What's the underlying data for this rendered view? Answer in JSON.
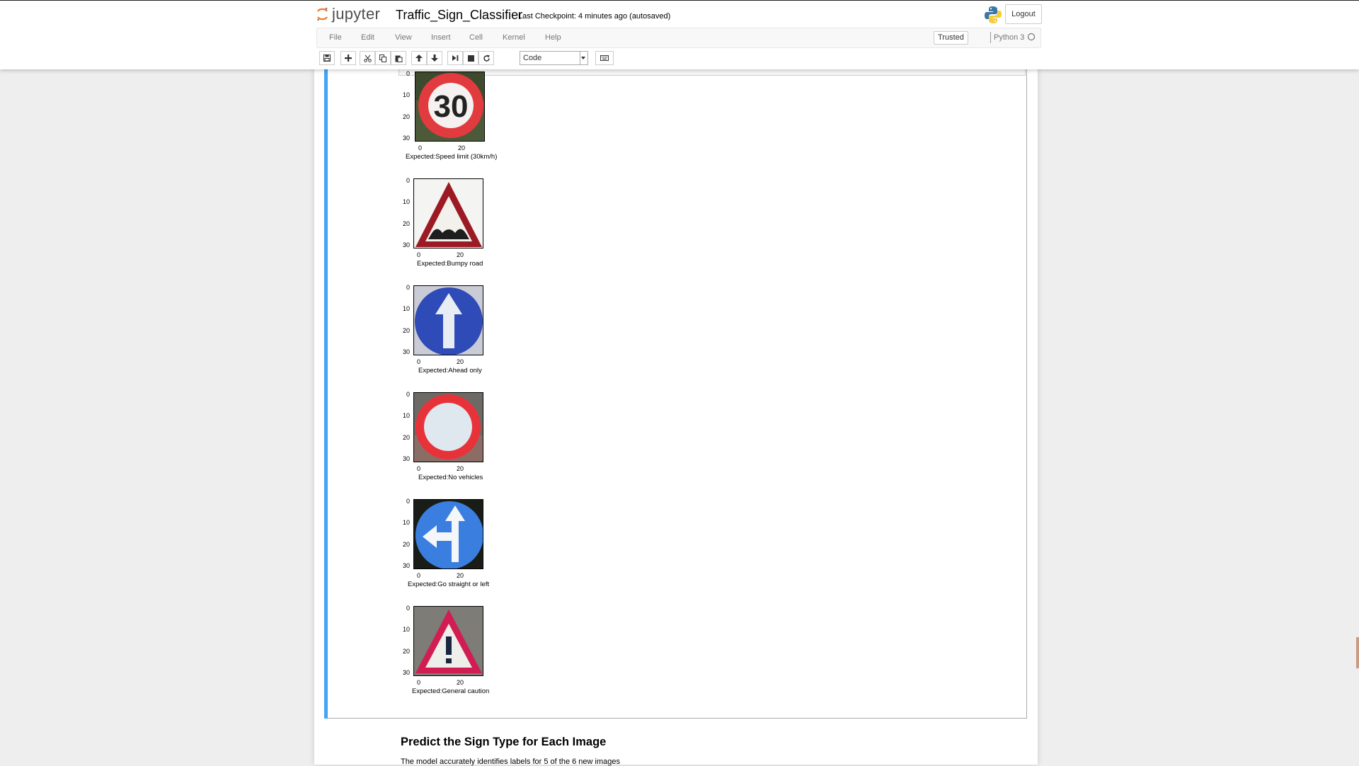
{
  "header": {
    "logo_text": "jupyter",
    "notebook_name": "Traffic_Sign_Classifier",
    "checkpoint_label": "Last Checkpoint:",
    "checkpoint_value": "4 minutes ago (autosaved)",
    "logout_label": "Logout"
  },
  "menu": {
    "items": [
      "File",
      "Edit",
      "View",
      "Insert",
      "Cell",
      "Kernel",
      "Help"
    ],
    "trusted_label": "Trusted",
    "kernel_name": "Python 3"
  },
  "toolbar": {
    "buttons": [
      "save-icon",
      "plus-icon",
      "scissors-icon",
      "copy-icon",
      "paste-icon",
      "arrow-up-icon",
      "arrow-down-icon",
      "step-forward-icon",
      "stop-icon",
      "refresh-icon",
      "keyboard-icon"
    ],
    "cell_type": "Code"
  },
  "output": {
    "yticks": [
      "0",
      "10",
      "20",
      "30"
    ],
    "xticks": [
      "0",
      "20"
    ],
    "images": [
      {
        "caption": "Expected:Speed limit (30km/h)",
        "sign": "speed-limit-30-sign"
      },
      {
        "caption": "Expected:Bumpy road",
        "sign": "bumpy-road-sign"
      },
      {
        "caption": "Expected:Ahead only",
        "sign": "ahead-only-sign"
      },
      {
        "caption": "Expected:No vehicles",
        "sign": "no-vehicles-sign"
      },
      {
        "caption": "Expected:Go straight or left",
        "sign": "go-straight-or-left-sign"
      },
      {
        "caption": "Expected:General caution",
        "sign": "general-caution-sign"
      }
    ]
  },
  "markdown": {
    "heading": "Predict the Sign Type for Each Image",
    "text": "The model accurately identifies labels for 5 of the 6 new images"
  },
  "colors": {
    "selected_cell_bar": "#42a5f5",
    "jupyter_orange": "#f37626"
  }
}
